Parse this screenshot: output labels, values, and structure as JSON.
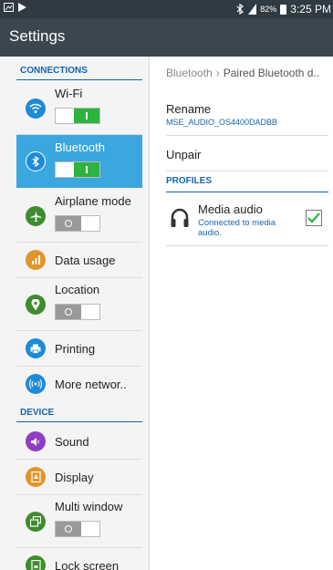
{
  "status_bar": {
    "battery_percent": "82%",
    "time": "3:25 PM"
  },
  "app_title": "Settings",
  "sidebar": {
    "sections": [
      {
        "header": "CONNECTIONS"
      },
      {
        "header": "DEVICE"
      }
    ],
    "items": [
      {
        "label": "Wi-Fi",
        "toggle": "on",
        "icon": "wifi-icon",
        "color": "#1e8bd6"
      },
      {
        "label": "Bluetooth",
        "toggle": "on",
        "icon": "bluetooth-icon",
        "color": "#1e8bd6",
        "selected": true
      },
      {
        "label": "Airplane mode",
        "toggle": "off",
        "icon": "airplane-icon",
        "color": "#3f8c2e"
      },
      {
        "label": "Data usage",
        "icon": "data-usage-icon",
        "color": "#e0962a"
      },
      {
        "label": "Location",
        "toggle": "off",
        "icon": "location-icon",
        "color": "#3f8c2e"
      },
      {
        "label": "Printing",
        "icon": "printer-icon",
        "color": "#1e8bd6"
      },
      {
        "label": "More networ..",
        "icon": "more-networks-icon",
        "color": "#1e8bd6"
      },
      {
        "label": "Sound",
        "icon": "sound-icon",
        "color": "#8e3fc6"
      },
      {
        "label": "Display",
        "icon": "display-icon",
        "color": "#e0962a"
      },
      {
        "label": "Multi window",
        "toggle": "off",
        "icon": "multi-window-icon",
        "color": "#3f8c2e"
      },
      {
        "label": "Lock screen",
        "icon": "lock-screen-icon",
        "color": "#3f8c2e"
      }
    ]
  },
  "detail": {
    "breadcrumb_root": "Bluetooth",
    "breadcrumb_current": "Paired Bluetooth d..",
    "rename_title": "Rename",
    "device_name": "MSE_AUDIO_OS4400DADBB",
    "unpair": "Unpair",
    "profiles_header": "PROFILES",
    "media_audio_title": "Media audio",
    "media_audio_sub": "Connected to media audio.",
    "media_audio_checked": true
  },
  "colors": {
    "accent": "#1565a8",
    "selected_bg": "#3aa7df",
    "toggle_on": "#2db33f",
    "check": "#2db33f"
  }
}
